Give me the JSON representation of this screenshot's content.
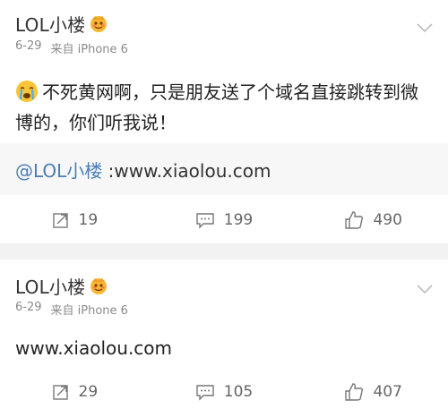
{
  "posts": [
    {
      "author": "LOL小楼",
      "date": "6-29",
      "source": "来自 iPhone 6",
      "text": "不死黄网啊，只是朋友送了个域名直接跳转到微博的，你们听我说！",
      "repost": {
        "mention": "@LOL小楼",
        "text": " :www.xiaolou.com"
      },
      "reposts": "19",
      "comments": "199",
      "likes": "490"
    },
    {
      "author": "LOL小楼",
      "date": "6-29",
      "source": "来自 iPhone 6",
      "text": "www.xiaolou.com",
      "reposts": "29",
      "comments": "105",
      "likes": "407"
    }
  ],
  "icons": {
    "vip": "vip-crown-icon",
    "cry": "crying-emoji-icon",
    "repost": "repost-icon",
    "comment": "comment-icon",
    "like": "thumbs-up-icon",
    "more": "chevron-down-icon"
  },
  "colors": {
    "mention": "#4a7db5",
    "badge": "#f5a623",
    "muted": "#8a8a8a"
  }
}
